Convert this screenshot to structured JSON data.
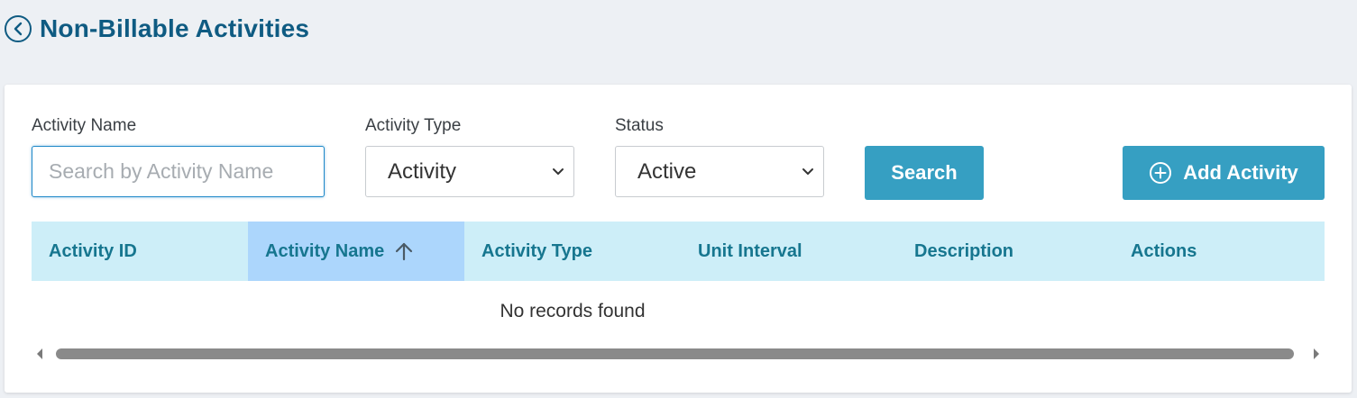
{
  "header": {
    "title": "Non-Billable Activities",
    "back_icon": "chevron-left-circle-icon"
  },
  "filters": {
    "activity_name": {
      "label": "Activity Name",
      "value": "",
      "placeholder": "Search by Activity Name"
    },
    "activity_type": {
      "label": "Activity Type",
      "selected": "Activity"
    },
    "status": {
      "label": "Status",
      "selected": "Active"
    }
  },
  "buttons": {
    "search": "Search",
    "add_activity": "Add Activity"
  },
  "table": {
    "columns": [
      "Activity ID",
      "Activity Name",
      "Activity Type",
      "Unit Interval",
      "Description",
      "Actions"
    ],
    "sorted_column": "Activity Name",
    "sort_direction": "ascending",
    "rows": [],
    "empty_message": "No records found"
  },
  "colors": {
    "title": "#0f5b82",
    "button": "#369fc2",
    "table_header": "#cdeef8",
    "sorted_header": "#acd6fc",
    "header_text": "#16768f"
  }
}
